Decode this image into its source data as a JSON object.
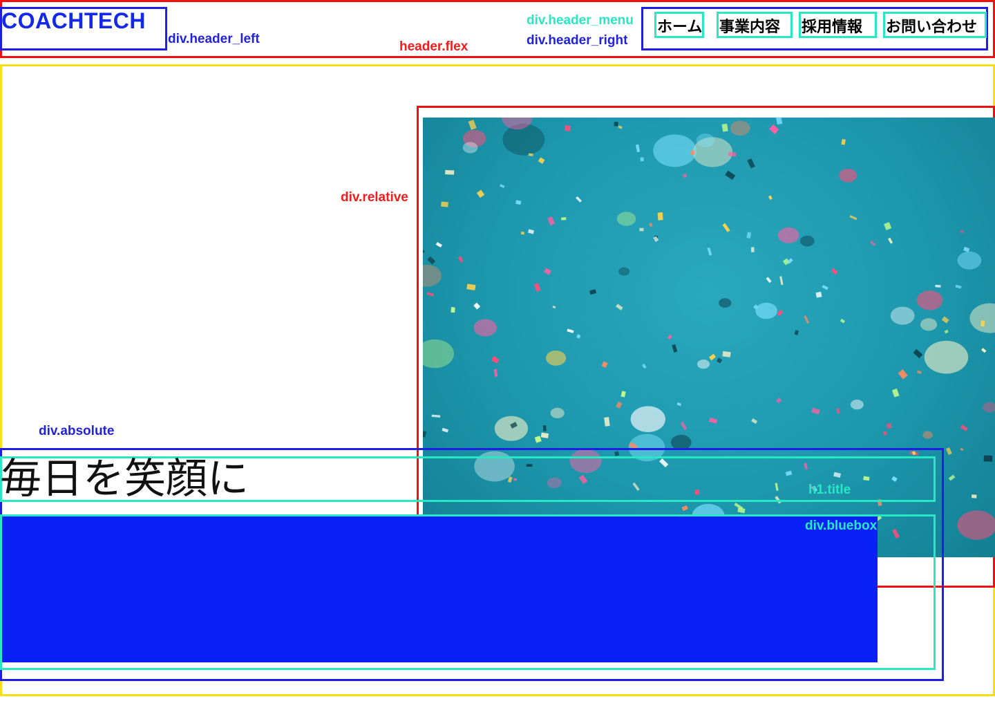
{
  "header": {
    "logo": "COACHTECH",
    "menu": [
      "ホーム",
      "事業内容",
      "採用情報",
      "お問い合わせ"
    ]
  },
  "debug_labels": {
    "header_flex": "header.flex",
    "header_left": "div.header_left",
    "header_menu": "div.header_menu",
    "header_right": "div.header_right",
    "relative": "div.relative",
    "absolute": "div.absolute",
    "title": "h1.title",
    "bluebox": "div.bluebox"
  },
  "main": {
    "title": "毎日を笑顔に",
    "photo_description_icon": "confetti-photo"
  },
  "colors": {
    "logo": "#1428e8",
    "bluebox": "#0a21f5",
    "photo_bg": "#1d97ad",
    "outline_red": "#f11010",
    "outline_blue": "#1e1ee6",
    "outline_cyan": "#28e8c4",
    "outline_yellow": "#f6de14"
  }
}
